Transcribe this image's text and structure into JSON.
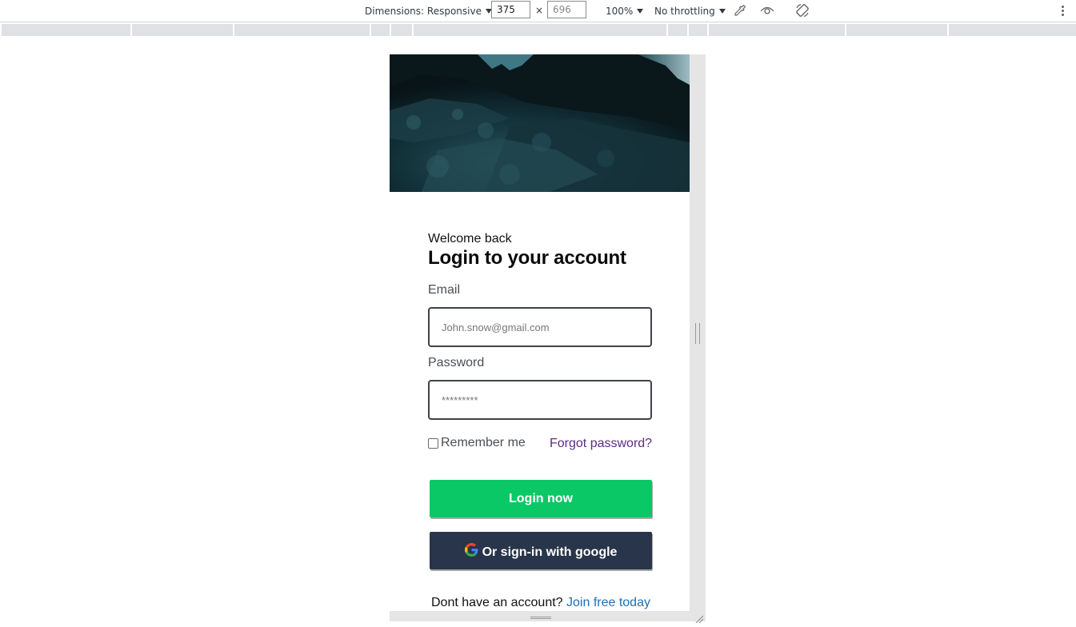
{
  "devtools": {
    "dimensions_label": "Dimensions: Responsive",
    "width_value": "375",
    "times": "×",
    "height_value": "696",
    "zoom": "100%",
    "throttling": "No throttling",
    "icons": [
      "eyedropper-icon",
      "eye-icon",
      "rotate-icon",
      "more-options-icon"
    ]
  },
  "login": {
    "welcome": "Welcome back",
    "title": "Login to your account",
    "email_label": "Email",
    "email_placeholder": "John.snow@gmail.com",
    "password_label": "Password",
    "password_placeholder": "*********",
    "remember_label": "Remember me",
    "forgot_label": "Forgot password?",
    "login_button": "Login now",
    "google_button": "Or sign-in with google",
    "signup_text": "Dont have an account?",
    "signup_link": "Join free today"
  },
  "colors": {
    "login_button": "#0bc866",
    "google_button": "#28354a",
    "forgot_link": "#5b2c83",
    "signup_link": "#1e6fb3",
    "hero_background": "#0c1a1e"
  }
}
